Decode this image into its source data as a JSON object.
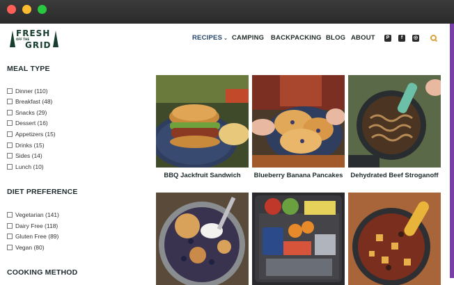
{
  "nav": {
    "logo_line1": "FRESH",
    "logo_line2": "OFF THE",
    "logo_line3": "GRID",
    "items": [
      {
        "label": "RECIPES",
        "caret": "⌄"
      },
      {
        "label": "CAMPING"
      },
      {
        "label": "BACKPACKING"
      },
      {
        "label": "BLOG"
      },
      {
        "label": "ABOUT"
      }
    ],
    "social": [
      "P",
      "f",
      "◎"
    ]
  },
  "sidebar": {
    "meal_type": {
      "title": "MEAL TYPE",
      "items": [
        "Dinner (110)",
        "Breakfast (48)",
        "Snacks (29)",
        "Dessert (16)",
        "Appetizers (15)",
        "Drinks (15)",
        "Sides (14)",
        "Lunch (10)"
      ]
    },
    "diet": {
      "title": "DIET PREFERENCE",
      "items": [
        "Vegetarian (141)",
        "Dairy Free (118)",
        "Gluten Free (89)",
        "Vegan (80)"
      ]
    },
    "cooking": {
      "title": "COOKING METHOD"
    }
  },
  "recipes": [
    {
      "title": "BBQ Jackfruit Sandwich"
    },
    {
      "title": "Blueberry Banana Pancakes"
    },
    {
      "title": "Dehydrated Beef Stroganoff"
    },
    {
      "title": ""
    },
    {
      "title": ""
    },
    {
      "title": ""
    }
  ],
  "colors": {
    "accent": "#7a3fa6",
    "nav_active": "#26486d",
    "brand_green": "#173d2d",
    "search": "#d9a13a"
  }
}
